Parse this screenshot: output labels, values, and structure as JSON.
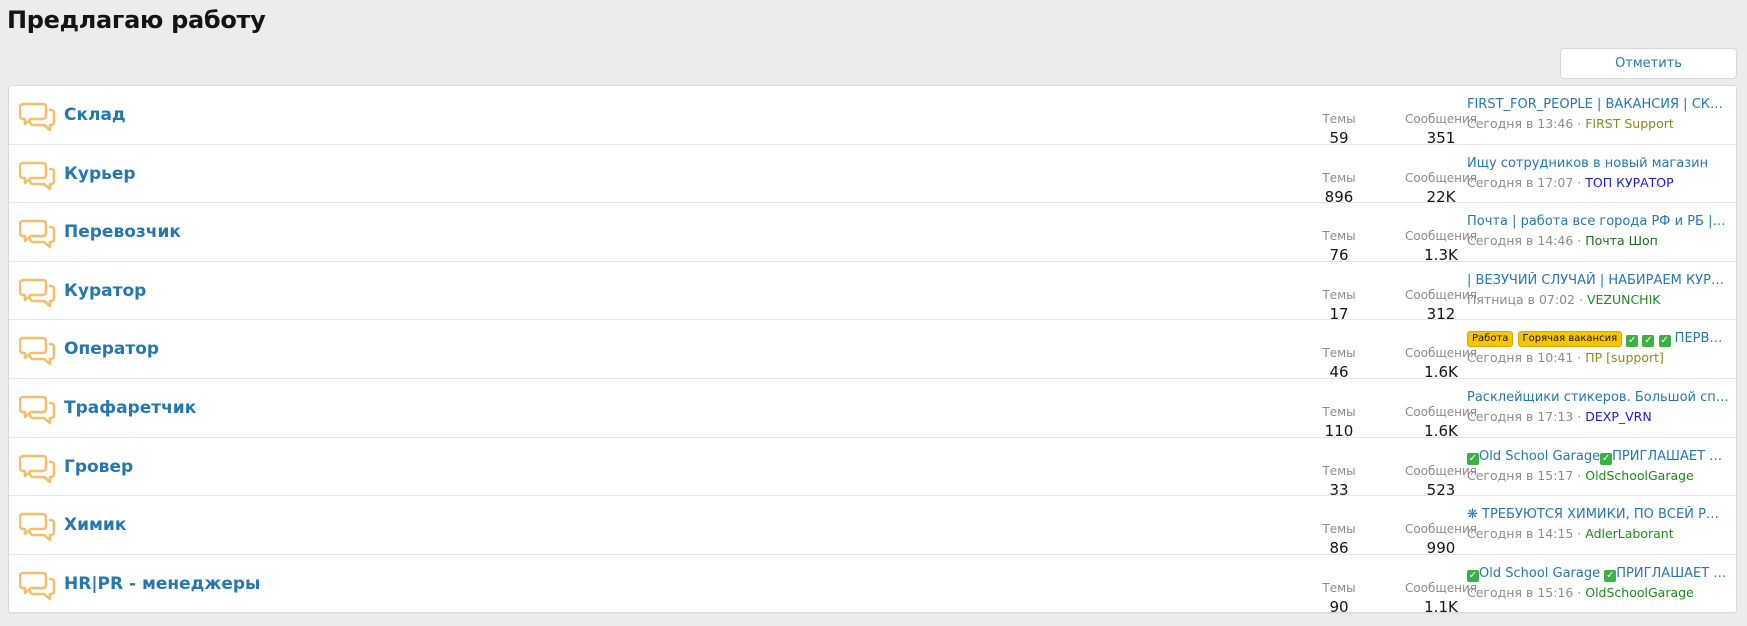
{
  "page": {
    "title": "Предлагаю работу",
    "mark_read_label": "Отметить прочитанным(и)"
  },
  "colors": {
    "link": "#2577b1",
    "icon": "#f5c06b",
    "muted": "#8c8c8c",
    "prefix_bg": "#f7c500"
  },
  "forums": [
    {
      "title": "Склад",
      "threads_label": "Темы",
      "threads": "59",
      "messages_label": "Сообщения",
      "messages": "351",
      "last_title": "FIRST_FOR_PEOPLE | ВАКАНСИЯ | СКЛАД | ...",
      "last_date": "Сегодня в 13:46",
      "sep": " · ",
      "last_user": "FIRST Support",
      "user_color": "#8a8a1a"
    },
    {
      "title": "Курьер",
      "threads_label": "Темы",
      "threads": "896",
      "messages_label": "Сообщения",
      "messages": "22K",
      "last_title": "Ищу сотрудников в новый магазин",
      "last_date": "Сегодня в 17:07",
      "sep": " · ",
      "last_user": "ТОП КУРАТОР",
      "user_color": "#1a1ae6"
    },
    {
      "title": "Перевозчик",
      "threads_label": "Темы",
      "threads": "76",
      "messages_label": "Сообщения",
      "messages": "1.3K",
      "last_title": "Почта | работа все города РФ и РБ | Пер...",
      "last_date": "Сегодня в 14:46",
      "sep": " · ",
      "last_user": "Почта Шоп",
      "user_color": "#1a6e1a"
    },
    {
      "title": "Куратор",
      "threads_label": "Темы",
      "threads": "17",
      "messages_label": "Сообщения",
      "messages": "312",
      "last_title": "| ВЕЗУЧИЙ СЛУЧАЙ | НАБИРАЕМ КУРАТО...",
      "last_date": "Пятница в 07:02",
      "sep": " · ",
      "last_user": "VEZUNCHIK",
      "user_color": "#1a8a1a"
    },
    {
      "title": "Оператор",
      "threads_label": "Темы",
      "threads": "46",
      "messages_label": "Сообщения",
      "messages": "1.6K",
      "prefixes": [
        "Работа",
        "Горячая вакансия"
      ],
      "last_title": "ПЕРВЫЙ ...",
      "last_date": "Сегодня в 10:41",
      "sep": " · ",
      "last_user": "ПР [support]",
      "user_color": "#8a8a1a"
    },
    {
      "title": "Трафаретчик",
      "threads_label": "Темы",
      "threads": "110",
      "messages_label": "Сообщения",
      "messages": "1.6K",
      "last_title": "Расклейщики стикеров. Большой список г...",
      "last_date": "Сегодня в 17:13",
      "sep": " · ",
      "last_user": "DEXP_VRN",
      "user_color": "#1a1ae6"
    },
    {
      "title": "Гровер",
      "threads_label": "Темы",
      "threads": "33",
      "messages_label": "Сообщения",
      "messages": "523",
      "last_title_a": "Old School Garage",
      "last_title_b": "ПРИГЛАШАЕТ ГРО...",
      "last_date": "Сегодня в 15:17",
      "sep": " · ",
      "last_user": "OldSchoolGarage",
      "user_color": "#1a8a1a"
    },
    {
      "title": "Химик",
      "threads_label": "Темы",
      "threads": "86",
      "messages_label": "Сообщения",
      "messages": "990",
      "last_title": "❋ ТРЕБУЮТСЯ ХИМИКИ, ПО ВСЕЙ РФ, КЗ...",
      "last_date": "Сегодня в 14:15",
      "sep": " · ",
      "last_user": "AdlerLaborant",
      "user_color": "#1a8a1a"
    },
    {
      "title": "HR|PR - менеджеры",
      "threads_label": "Темы",
      "threads": "90",
      "messages_label": "Сообщения",
      "messages": "1.1K",
      "last_title_a": "Old School Garage ",
      "last_title_b": "ПРИГЛАШАЕТ HR ...",
      "last_date": "Сегодня в 15:16",
      "sep": " · ",
      "last_user": "OldSchoolGarage",
      "user_color": "#1a8a1a"
    }
  ]
}
